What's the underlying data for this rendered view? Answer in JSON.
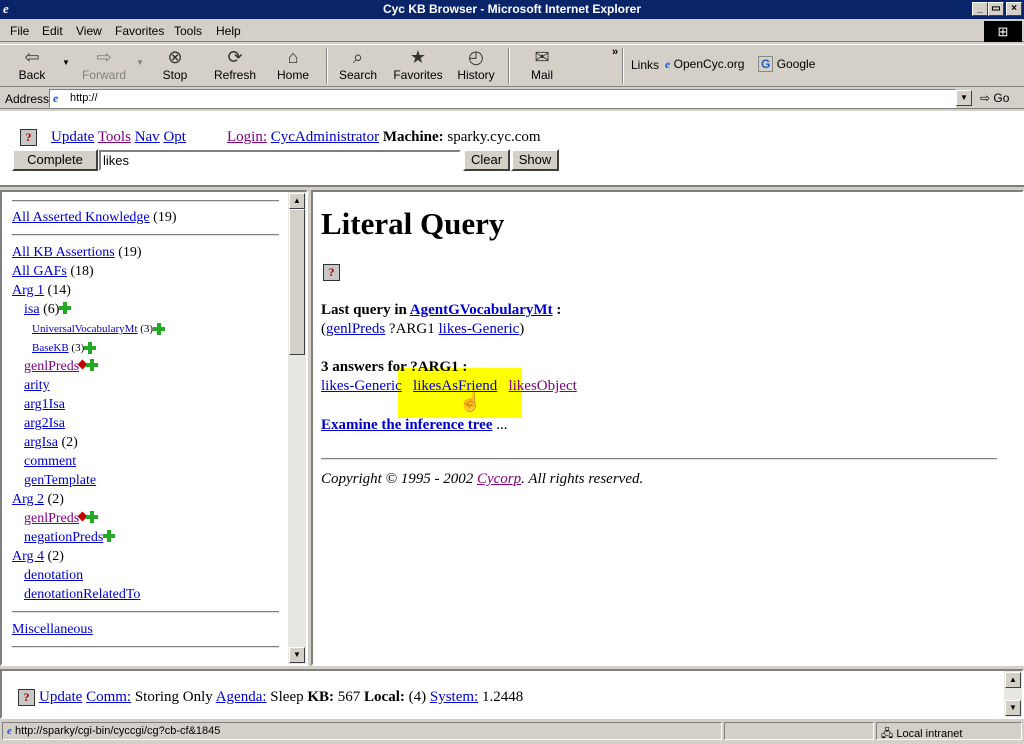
{
  "window": {
    "title": "Cyc KB Browser - Microsoft Internet Explorer"
  },
  "menu": [
    "File",
    "Edit",
    "View",
    "Favorites",
    "Tools",
    "Help"
  ],
  "toolbar": {
    "back": "Back",
    "forward": "Forward",
    "stop": "Stop",
    "refresh": "Refresh",
    "home": "Home",
    "search": "Search",
    "favorites": "Favorites",
    "history": "History",
    "mail": "Mail",
    "links_label": "Links",
    "link1": "OpenCyc.org",
    "link2": "Google"
  },
  "address": {
    "label": "Address",
    "value": "http://",
    "go": "Go"
  },
  "control": {
    "update": "Update",
    "tools": "Tools",
    "nav": "Nav",
    "opt": "Opt",
    "login_label": "Login:",
    "login_user": "CycAdministrator",
    "machine_label": "Machine:",
    "machine_value": "sparky.cyc.com",
    "complete": "Complete",
    "search_value": "likes",
    "clear": "Clear",
    "show": "Show"
  },
  "tree": {
    "all_asserted": "All Asserted Knowledge",
    "all_asserted_count": "(19)",
    "all_kb": "All KB Assertions",
    "all_kb_count": "(19)",
    "all_gafs": "All GAFs",
    "all_gafs_count": "(18)",
    "arg1": "Arg 1",
    "arg1_count": "(14)",
    "isa": "isa",
    "isa_count": "(6)",
    "uvmt": "UniversalVocabularyMt",
    "uvmt_count": "(3)",
    "basekb": "BaseKB",
    "basekb_count": "(3)",
    "genlpreds": "genlPreds",
    "arity": "arity",
    "arg1isa": "arg1Isa",
    "arg2isa": "arg2Isa",
    "argisa": "argIsa",
    "argisa_count": "(2)",
    "comment": "comment",
    "gentemplate": "genTemplate",
    "arg2": "Arg 2",
    "arg2_count": "(2)",
    "genlpreds2": "genlPreds",
    "negationpreds": "negationPreds",
    "arg4": "Arg 4",
    "arg4_count": "(2)",
    "denotation": "denotation",
    "denotationrelated": "denotationRelatedTo",
    "misc": "Miscellaneous"
  },
  "main": {
    "title": "Literal Query",
    "last_query_label": "Last query in",
    "last_query_mt": "AgentGVocabularyMt",
    "colon": ":",
    "q_paren_open": "(",
    "q_pred": "genlPreds",
    "q_var": "?ARG1",
    "q_arg": "likes-Generic",
    "q_paren_close": ")",
    "answers_label": "3 answers for ?ARG1 :",
    "answers": [
      "likes-Generic",
      "likesAsFriend",
      "likesObject"
    ],
    "examine": "Examine the inference tree",
    "ellipsis": "...",
    "copyright": "Copyright © 1995 - 2002",
    "cycorp": "Cycorp",
    "rights": ". All rights reserved."
  },
  "bottom": {
    "update": "Update",
    "comm": "Comm:",
    "comm_value": "Storing Only",
    "agenda": "Agenda:",
    "agenda_value": "Sleep",
    "kb_label": "KB:",
    "kb_value": "567",
    "local_label": "Local:",
    "local_value": "(4)",
    "system": "System:",
    "system_value": "1.2448"
  },
  "statusbar": {
    "url": "http://sparky/cgi-bin/cyccgi/cg?cb-cf&1845",
    "zone": "Local intranet"
  },
  "colors": {
    "title_bg": "#0a246a",
    "link": "#0000cc",
    "visited": "#800080",
    "highlight": "#ffff00",
    "chrome": "#d4d0c8"
  }
}
